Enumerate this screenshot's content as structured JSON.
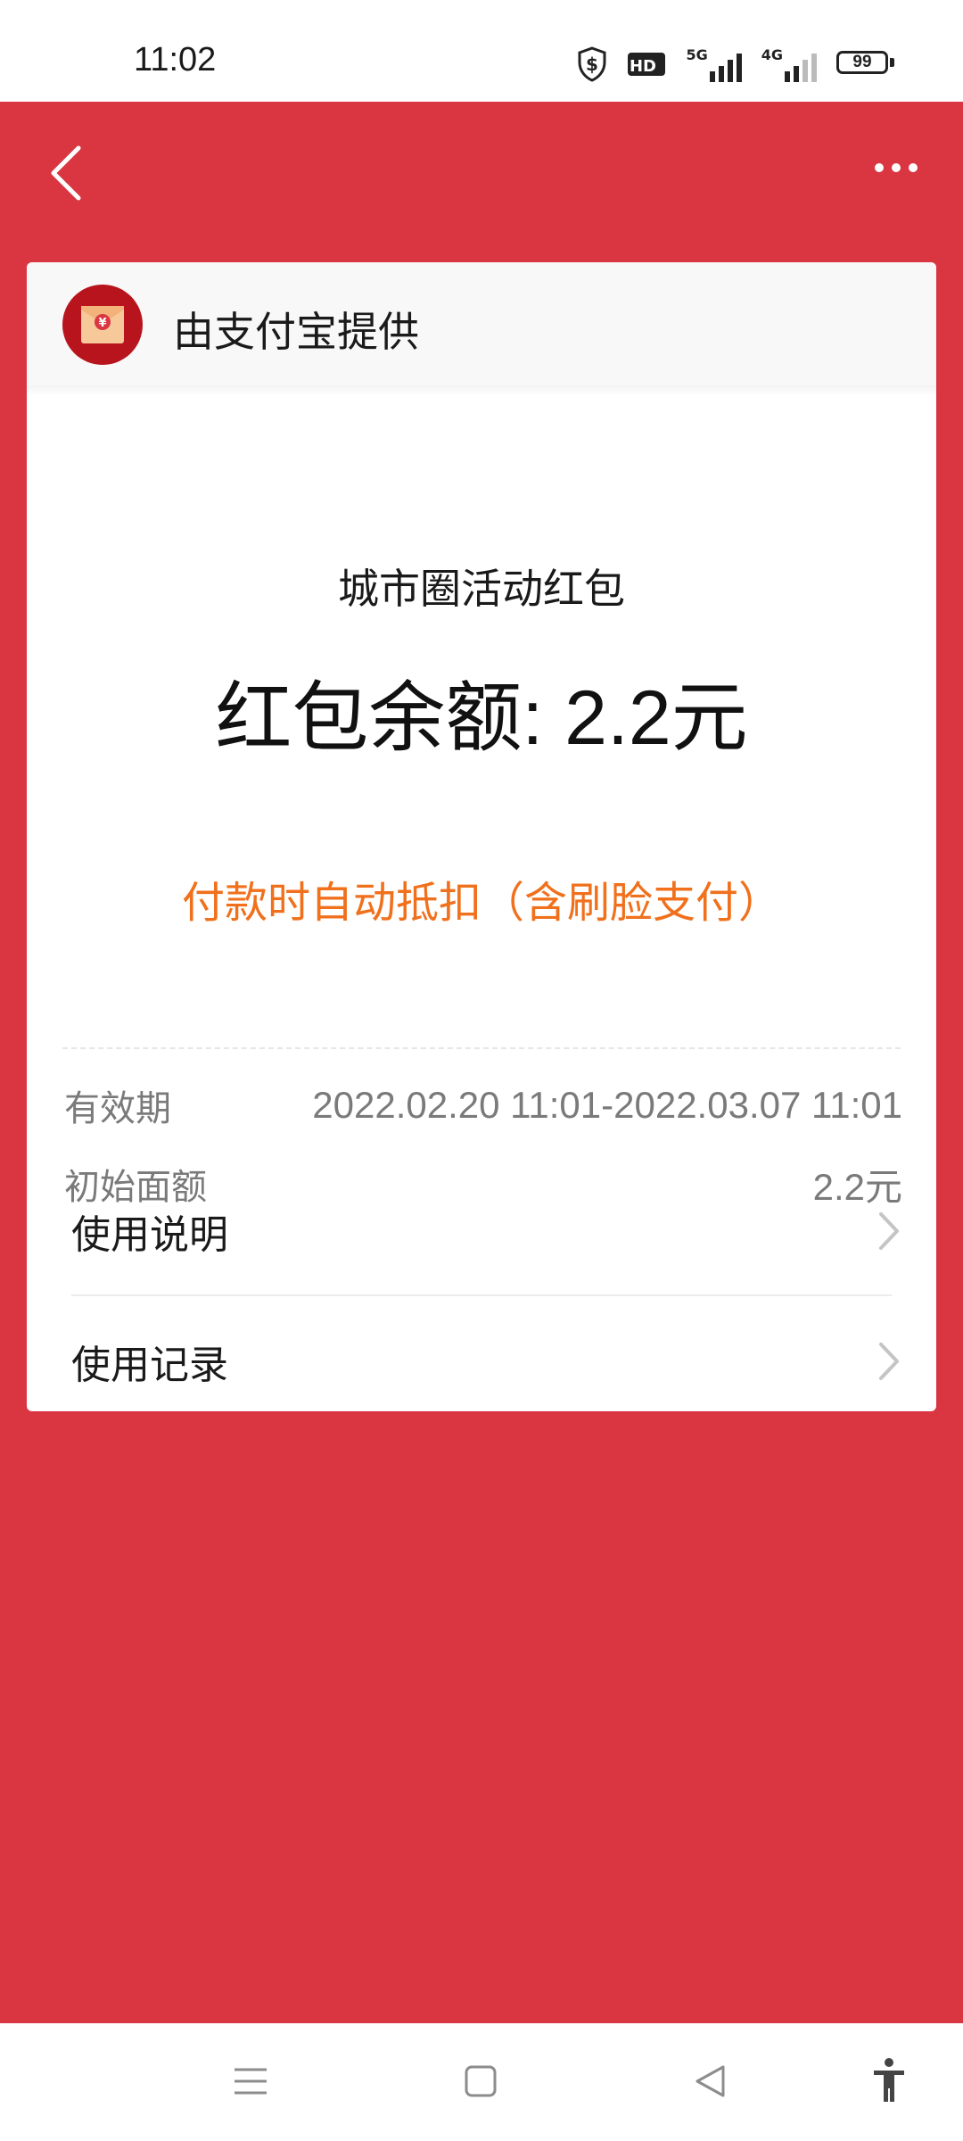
{
  "status_bar": {
    "time": "11:02",
    "network_5g": "5G",
    "network_4g": "4G",
    "battery": "99"
  },
  "header": {
    "back_icon": "chevron-left-icon",
    "more_icon": "more-horizontal-icon"
  },
  "card": {
    "provider": "由支付宝提供",
    "logo_icon": "red-envelope-yen-icon",
    "title": "城市圈活动红包",
    "balance": "红包余额: 2.2元",
    "note": "付款时自动抵扣（含刷脸支付）",
    "validity": {
      "label": "有效期",
      "value": "2022.02.20 11:01-2022.03.07 11:01"
    },
    "initial_amount": {
      "label": "初始面额",
      "value": "2.2元"
    },
    "links": [
      {
        "label": "使用说明",
        "icon": "chevron-right-icon"
      },
      {
        "label": "使用记录",
        "icon": "chevron-right-icon"
      }
    ]
  },
  "colors": {
    "background": "#d93642",
    "note": "#f0701c",
    "logo": "#b8141d"
  }
}
